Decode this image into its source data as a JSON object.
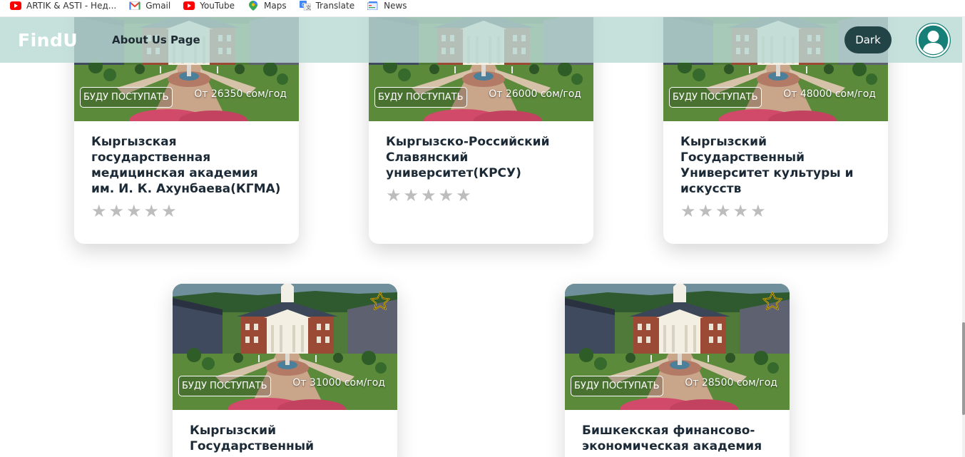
{
  "bookmarks": [
    {
      "label": "ARTIK & ASTI - Нед...",
      "icon": "youtube-icon"
    },
    {
      "label": "Gmail",
      "icon": "gmail-icon"
    },
    {
      "label": "YouTube",
      "icon": "youtube-icon"
    },
    {
      "label": "Maps",
      "icon": "maps-icon"
    },
    {
      "label": "Translate",
      "icon": "translate-icon"
    },
    {
      "label": "News",
      "icon": "news-icon"
    }
  ],
  "header": {
    "logo": "FindU",
    "nav_about": "About Us Page",
    "theme_button": "Dark",
    "avatar_icon": "user-icon"
  },
  "colors": {
    "header_bg": "#b9dbd4",
    "dark_button": "#234446",
    "avatar": "#167f78",
    "title_text": "#1b2a36",
    "star_empty": "#bdbdbd",
    "favorite_star": "#f2c200"
  },
  "universities": [
    {
      "enroll_label": "БУДУ ПОСТУПАТЬ",
      "price": "От 26350 сом/год",
      "name": "Кыргызская государственная медицинская академия им. И. К. Ахунбаева(КГМА)",
      "rating": 0
    },
    {
      "enroll_label": "БУДУ ПОСТУПАТЬ",
      "price": "От 26000 сом/год",
      "name": "Кыргызско-Российский Славянский университет(КРСУ)",
      "rating": 0
    },
    {
      "enroll_label": "БУДУ ПОСТУПАТЬ",
      "price": "От 48000 сом/год",
      "name": "Кыргызский Государственный Университет культуры и искусств",
      "rating": 0
    },
    {
      "enroll_label": "БУДУ ПОСТУПАТЬ",
      "price": "От 31000 сом/год",
      "name": "Кыргызский Государственный",
      "favorite_icon": "star-outline-icon",
      "rating": 0
    },
    {
      "enroll_label": "БУДУ ПОСТУПАТЬ",
      "price": "От 28500 сом/год",
      "name": "Бишкекская финансово-экономическая академия",
      "favorite_icon": "star-outline-icon",
      "rating": 0
    }
  ]
}
